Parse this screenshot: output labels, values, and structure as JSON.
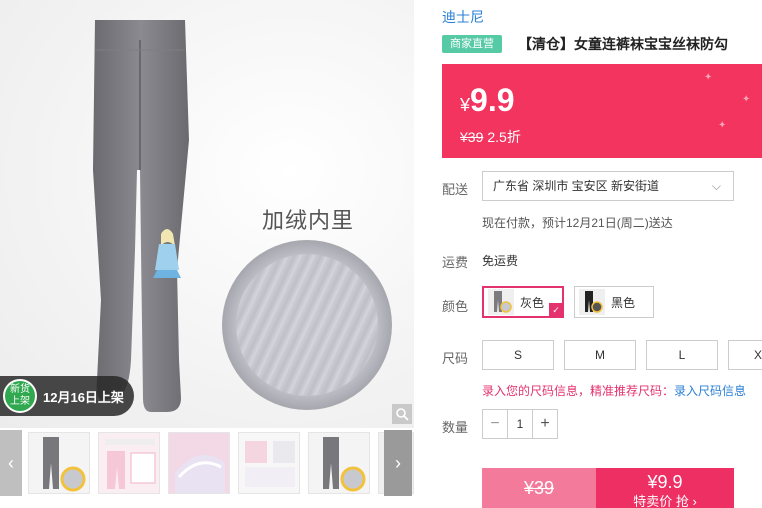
{
  "gallery": {
    "image_caption": "加绒内里",
    "new_badge": {
      "line1": "新货",
      "line2": "上架",
      "text": "12月16日上架"
    },
    "prev_arrow": "‹",
    "next_arrow": "›"
  },
  "product": {
    "brand": "迪士尼",
    "shop_tag": "商家直营",
    "title": "【清仓】女童连裤袜宝宝丝袜防勾",
    "price": {
      "currency": "¥",
      "value": "9.9",
      "original": "¥39",
      "discount": "2.5折"
    }
  },
  "delivery": {
    "label": "配送",
    "address": "广东省 深圳市 宝安区 新安街道",
    "note": "现在付款，预计12月21日(周二)送达"
  },
  "shipping": {
    "label": "运费",
    "value": "免运费"
  },
  "colors": {
    "label": "颜色",
    "options": [
      {
        "name": "灰色",
        "selected": true
      },
      {
        "name": "黑色",
        "selected": false
      }
    ]
  },
  "sizes": {
    "label": "尺码",
    "options": [
      "S",
      "M",
      "L",
      "X"
    ],
    "note": "录入您的尺码信息，精准推荐尺码：",
    "note_link": "录入尺码信息"
  },
  "quantity": {
    "label": "数量",
    "value": "1",
    "minus": "−",
    "plus": "+"
  },
  "buy": {
    "original_price": "¥39",
    "special_price": "¥9.9",
    "special_label": "特卖价 抢 ›"
  },
  "colors_hex": {
    "accent": "#f2345f",
    "link": "#2b80d6",
    "shop_tag": "#56c9a5"
  }
}
